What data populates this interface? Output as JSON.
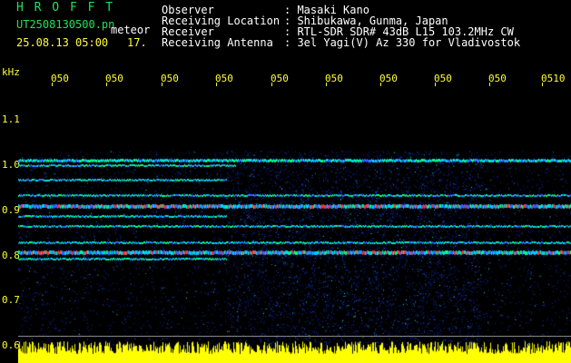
{
  "header": {
    "station": "H R O F F T",
    "filename": "UT2508130500.pn",
    "suffix": "meteor",
    "datetime": "25.08.13 05:00",
    "count": "17.",
    "fields": [
      {
        "label": "Observer",
        "value": ": Masaki Kano"
      },
      {
        "label": "Receiving Location",
        "value": ": Shibukawa, Gunma, Japan"
      },
      {
        "label": "Receiver",
        "value": ": RTL-SDR SDR# 43dB L15 103.2MHz CW"
      },
      {
        "label": "Receiving Antenna",
        "value": ": 3el Yagi(V) Az 330 for Vladivostok"
      }
    ]
  },
  "axis": {
    "unit": "kHz",
    "x_ticks": [
      "050",
      "050",
      "050",
      "050",
      "050",
      "050",
      "050",
      "050",
      "050",
      "0510"
    ],
    "y_ticks": [
      "1.1",
      "1.0",
      "0.9",
      "0.8",
      "0.7",
      "0.6"
    ]
  },
  "colors": {
    "background": "#000000",
    "tick": "#ffff33",
    "title": "#22e05a",
    "text": "#ffffff",
    "spectrum_floor": "#00008b",
    "spectrum_signal": "#ff2020",
    "audio_level": "#ffff00"
  }
}
